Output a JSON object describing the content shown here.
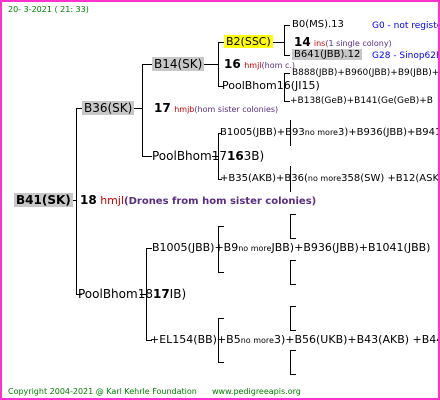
{
  "header": {
    "date": "20-  3-2021 ( 21: 33)"
  },
  "footer": {
    "copyright": "Copyright 2004-2021 @ Karl Kehrle Foundation",
    "url": "www.pedigreeapis.org"
  },
  "colors": {
    "border": "#ff33cc",
    "footer_green": "#008000",
    "red": "#cc0000",
    "purple": "#5a2d82",
    "blue": "#0000ff"
  },
  "root": {
    "label": "B41(SK)",
    "number": "18",
    "hmj": "hmjl",
    "note": "(Drones from hom sister colonies)"
  },
  "gen1": {
    "top": {
      "label": "B36(SK)",
      "number": "17",
      "hmj": "hmjb",
      "note": "(hom sister colonies)"
    },
    "bottom": {
      "label": "PoolBhom18",
      "number": "17",
      "suffix": "IB)"
    }
  },
  "gen2": {
    "b14": {
      "label": "B14(SK)",
      "number": "16",
      "hmj": "hmjl",
      "note": "(hom c.)"
    },
    "pool1716": {
      "prefix": "PoolBhom17",
      "number": "16",
      "suffix": "3B)"
    },
    "b1005": {
      "text": "B1005(JBB)+B9",
      "mid": "no more",
      "tail": "JBB)+B936(JBB)+B1041(JBB)"
    },
    "el154": {
      "text": "+EL154(BB)+B5",
      "mid": "no more",
      "tail": "3)+B56(UKB)+B43(AKB) +B44(AKB)"
    }
  },
  "gen3": {
    "b2ssc": "B2(SSC)",
    "n14": "14",
    "ins": "ins",
    "single": "(1 single colony)",
    "poolbhom16": "PoolBhom16(JI15)",
    "b1005_b93": {
      "text": "B1005(JBB)+B93",
      "mid": "no more",
      "tail": "3)+B936(JBB)+B941B"
    },
    "b35": {
      "text": "+B35(AKB)+B36(",
      "mid": "no more",
      "tail": "358(SW) +B12(ASK)"
    },
    "b888": "B888(JBB)+B960(JBB)+B9",
    "b888_tail": "(JBB)+B",
    "b138": "+B138(GeB)+B141(Ge",
    "b138_tail": "(GeB)+B"
  },
  "gen4": {
    "b0ms": "B0(MS).13",
    "g0": "G0 - not registe",
    "b641": "B641(JBB).12",
    "g28": "G28 - Sinop62R"
  }
}
